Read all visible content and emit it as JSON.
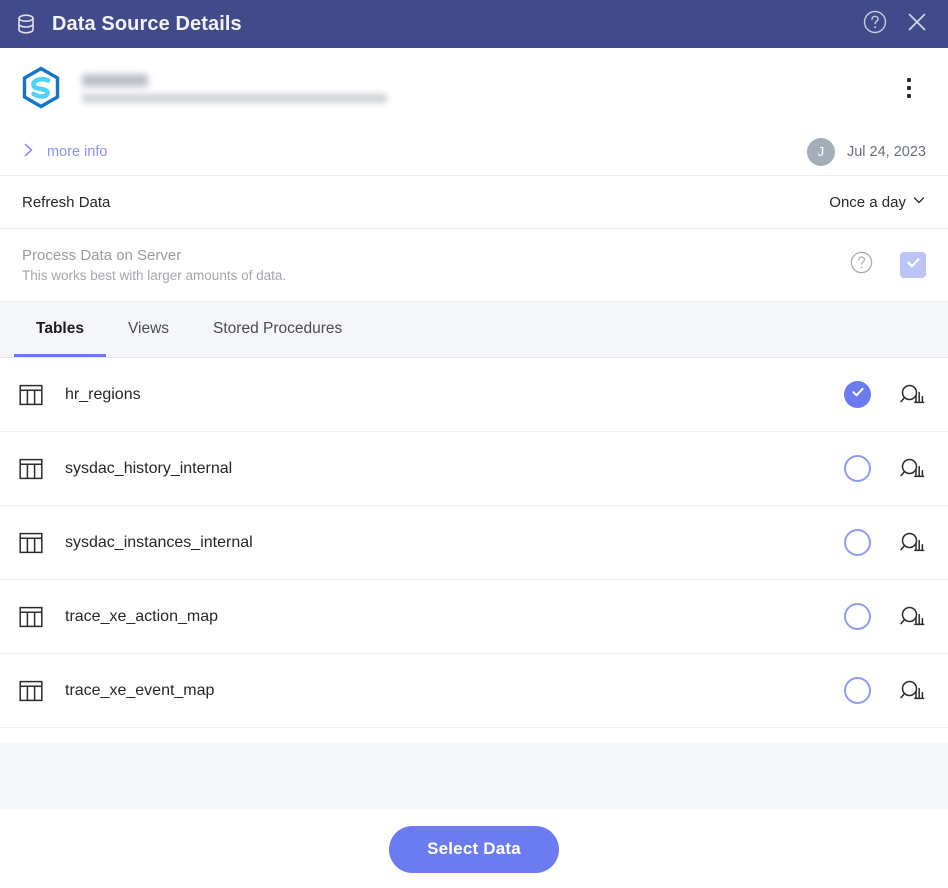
{
  "titlebar": {
    "title": "Data Source Details",
    "db_icon": "database-icon",
    "help_icon": "help-circle-icon",
    "close_icon": "close-icon",
    "bg_color": "#414B8A"
  },
  "source": {
    "logo_icon": "hexagon-s-logo",
    "name_redacted": "",
    "connection_redacted": "",
    "menu_icon": "kebab-menu-icon"
  },
  "more_info": {
    "label": "more info",
    "chevron_icon": "chevron-right-icon",
    "avatar_initial": "J",
    "date": "Jul 24, 2023"
  },
  "refresh": {
    "label": "Refresh Data",
    "value": "Once a day",
    "chevron_icon": "chevron-down-icon",
    "options": [
      "Once a day"
    ]
  },
  "process": {
    "title": "Process Data on Server",
    "subtitle": "This works best with larger amounts of data.",
    "help_icon": "help-circle-icon",
    "checkbox_icon": "check-icon",
    "checked": true
  },
  "tabs": {
    "active_index": 0,
    "items": [
      {
        "label": "Tables"
      },
      {
        "label": "Views"
      },
      {
        "label": "Stored Procedures"
      }
    ]
  },
  "tables": [
    {
      "name": "hr_regions",
      "selected": true
    },
    {
      "name": "sysdac_history_internal",
      "selected": false
    },
    {
      "name": "sysdac_instances_internal",
      "selected": false
    },
    {
      "name": "trace_xe_action_map",
      "selected": false
    },
    {
      "name": "trace_xe_event_map",
      "selected": false
    }
  ],
  "row_icons": {
    "table_icon": "table-grid-icon",
    "preview_icon": "preview-data-icon"
  },
  "footer": {
    "select_data_label": "Select Data"
  },
  "colors": {
    "accent": "#6C7BF0",
    "header": "#414B8A",
    "panel_bg": "#F5F6FA",
    "muted_text": "#9A9AA0"
  }
}
